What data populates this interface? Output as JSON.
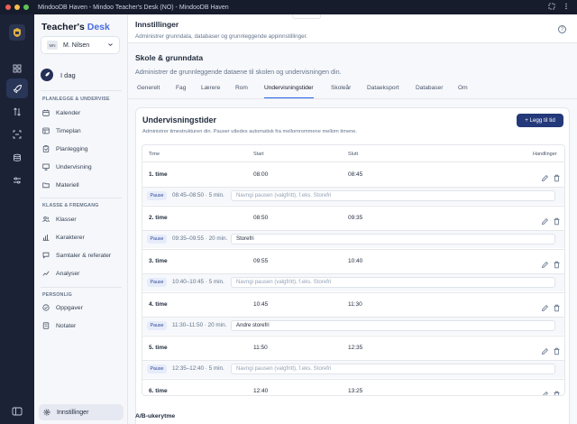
{
  "window": {
    "title": "MindooDB Haven - Mindoo Teacher's Desk (NO) - MindooDB Haven"
  },
  "brand": {
    "part1": "Teacher's ",
    "part2": "Desk"
  },
  "user": {
    "initials": "MN",
    "name": "M. Nilsen"
  },
  "nav": {
    "today": "I dag",
    "sec1": "PLANLEGGE & UNDERVISE",
    "sec1_items": [
      "Kalender",
      "Timeplan",
      "Planlegging",
      "Undervisning",
      "Materiell"
    ],
    "sec2": "KLASSE & FREMGANG",
    "sec2_items": [
      "Klasser",
      "Karakterer",
      "Samtaler & referater",
      "Analyser"
    ],
    "sec3": "PERSONLIG",
    "sec3_items": [
      "Oppgaver",
      "Notater"
    ],
    "settings": "Innstillinger"
  },
  "header": {
    "title": "Innstillinger",
    "subtitle": "Administrer grunndata, databaser og grunnleggende appinnstillinger.",
    "help": "?"
  },
  "section": {
    "title": "Skole & grunndata",
    "subtitle": "Administrer de grunnleggende dataene til skolen og undervisningen din."
  },
  "tabs": [
    "Generelt",
    "Fag",
    "Lærere",
    "Rom",
    "Undervisningstider",
    "Skoleår",
    "Dataeksport",
    "Databaser",
    "Om"
  ],
  "card": {
    "title": "Undervisningstider",
    "subtitle": "Administrer timestrukturen din. Pauser utledes automatisk fra mellomrommene mellom timene.",
    "add_button": "+ Legg til tid",
    "columns": [
      "Time",
      "Start",
      "Slutt",
      "Handlinger"
    ],
    "pause_label": "Pause",
    "rows": [
      {
        "name": "1. time",
        "start": "08:00",
        "end": "08:45"
      },
      {
        "name": "2. time",
        "start": "08:50",
        "end": "09:35"
      },
      {
        "name": "3. time",
        "start": "09:55",
        "end": "10:40"
      },
      {
        "name": "4. time",
        "start": "10:45",
        "end": "11:30"
      },
      {
        "name": "5. time",
        "start": "11:50",
        "end": "12:35"
      },
      {
        "name": "6. time",
        "start": "12:40",
        "end": "13:25"
      }
    ],
    "pauses": [
      {
        "time": "08:45–08:50 · 5 min.",
        "value": "",
        "placeholder": "Navngi pausen (valgfritt), f.eks. Storefri"
      },
      {
        "time": "09:35–09:55 · 20 min.",
        "value": "Storefri",
        "placeholder": ""
      },
      {
        "time": "10:40–10:45 · 5 min.",
        "value": "",
        "placeholder": "Navngi pausen (valgfritt), f.eks. Storefri"
      },
      {
        "time": "11:30–11:50 · 20 min.",
        "value": "Andre storefri",
        "placeholder": ""
      },
      {
        "time": "12:35–12:40 · 5 min.",
        "value": "",
        "placeholder": "Navngi pausen (valgfritt), f.eks. Storefri"
      }
    ]
  },
  "ab_section": {
    "title": "A/B-ukerytme"
  },
  "colors": {
    "accent": "#24397a",
    "tab_active": "#2563eb",
    "rail": "#1b2236"
  }
}
